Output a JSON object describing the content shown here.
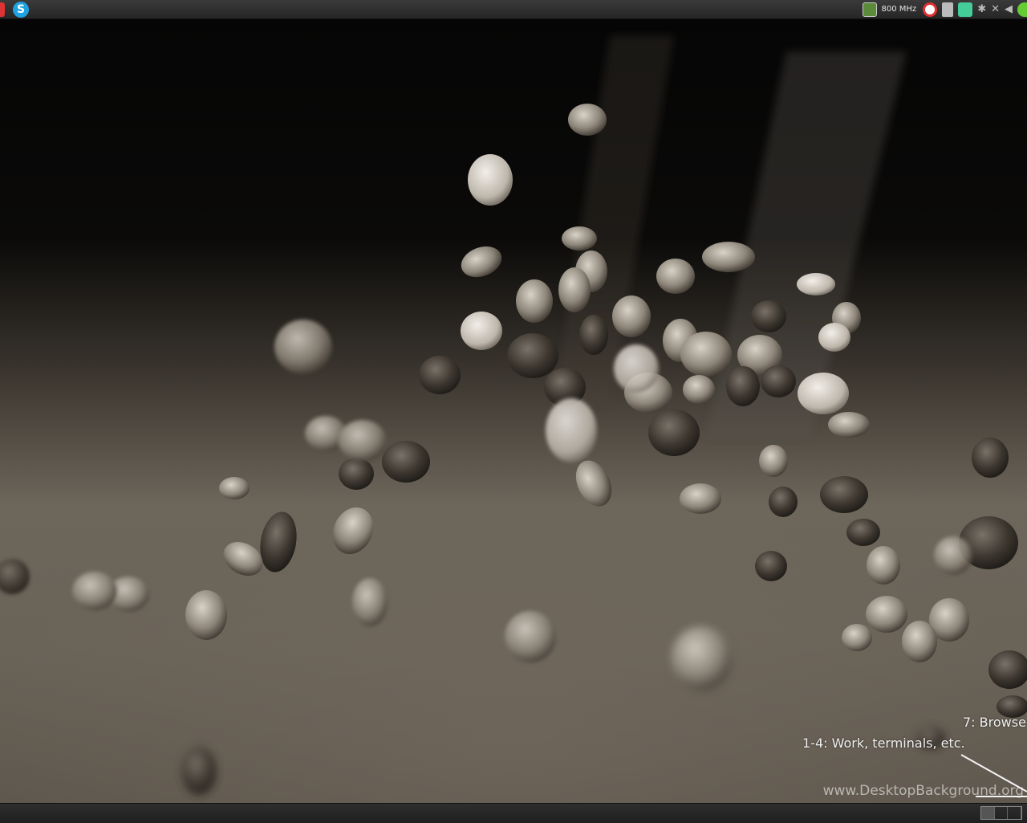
{
  "top_panel": {
    "launchers": [
      "skype-icon"
    ],
    "tray": {
      "cpu_frequency": "800 MHz",
      "icons": [
        "cpu-monitor-icon",
        "target-icon",
        "device-icon",
        "network-icon",
        "bluetooth-icon",
        "connection-icon",
        "volume-icon",
        "update-check-icon"
      ]
    }
  },
  "desktop": {
    "annotations": {
      "browser": "7: Browse",
      "work": "1-4: Work, terminals, etc."
    },
    "watermark": "www.DesktopBackground.org"
  },
  "bottom_panel": {
    "pager_desktops": 3
  }
}
